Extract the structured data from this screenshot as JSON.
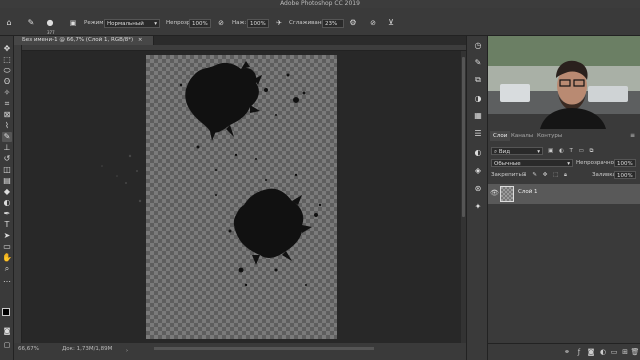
{
  "window": {
    "title": "Adobe Photoshop CC 2019"
  },
  "options_bar": {
    "mode_label": "Режим:",
    "mode_value": "Нормальный",
    "opacity_label": "Непрозр:",
    "opacity_value": "100%",
    "flow_label": "Наж:",
    "flow_value": "100%",
    "smoothing_label": "Сглаживание:",
    "smoothing_value": "23%",
    "brush_size": "377"
  },
  "document": {
    "tab_title": "Без имени-1 @ 66,7% (Слой 1, RGB/8*)",
    "zoom": "66,67%",
    "doc_info": "Док: 1,73M/1,89M"
  },
  "layers_panel": {
    "tabs": [
      "Слои",
      "Каналы",
      "Контуры"
    ],
    "filter_label": "Вид",
    "blend_mode": "Обычные",
    "opacity_label": "Непрозрачность:",
    "opacity_value": "100%",
    "lock_label": "Закрепить:",
    "fill_label": "Заливка:",
    "fill_value": "100%",
    "layers": [
      {
        "name": "Слой 1"
      }
    ]
  },
  "icons": {
    "tools": [
      "move-icon",
      "artboard-icon",
      "marquee-icon",
      "lasso-icon",
      "quick-select-icon",
      "crop-icon",
      "frame-icon",
      "eyedropper-icon",
      "healing-icon",
      "brush-icon",
      "stamp-icon",
      "history-brush-icon",
      "eraser-icon",
      "gradient-icon",
      "blur-icon",
      "dodge-icon",
      "pen-icon",
      "type-icon",
      "path-select-icon",
      "rectangle-icon",
      "hand-icon",
      "zoom-icon",
      "more-icon"
    ]
  }
}
